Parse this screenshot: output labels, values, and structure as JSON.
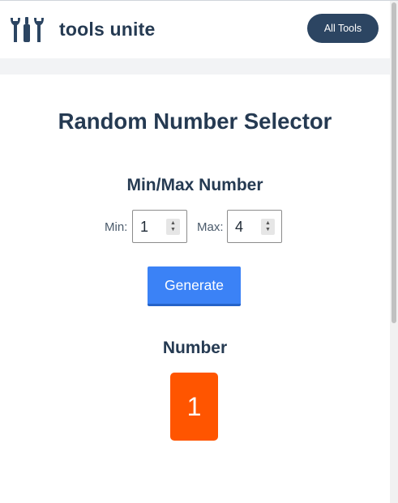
{
  "header": {
    "logo_icon": "wrench-tools-icon",
    "brand": "tools unite",
    "all_tools_label": "All Tools"
  },
  "main": {
    "title": "Random Number Selector",
    "range_heading": "Min/Max Number",
    "min": {
      "label": "Min:",
      "value": "1"
    },
    "max": {
      "label": "Max:",
      "value": "4"
    },
    "generate_label": "Generate",
    "result_heading": "Number",
    "result_value": "1"
  },
  "colors": {
    "brand_dark": "#2c4562",
    "heading": "#253a52",
    "button_blue": "#3b82f6",
    "result_orange": "#ff5500"
  }
}
